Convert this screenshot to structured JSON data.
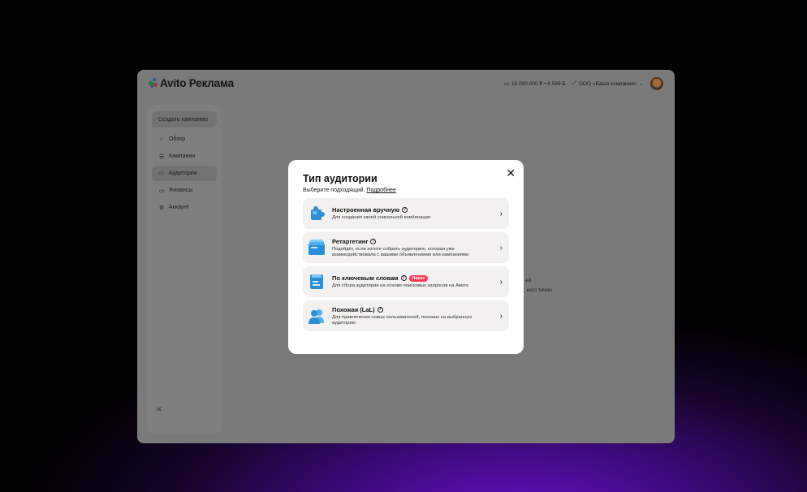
{
  "header": {
    "logo_text": "Avito Реклама",
    "balance": "15 000 000 ₽ • 6 589 Б",
    "company": "ООО «Ваша компания»"
  },
  "sidebar": {
    "create_label": "Создать кампанию",
    "items": [
      {
        "label": "Обзор",
        "icon": "overview-icon"
      },
      {
        "label": "Кампании",
        "icon": "list-icon"
      },
      {
        "label": "Аудитории",
        "icon": "users-icon"
      },
      {
        "label": "Финансы",
        "icon": "wallet-icon"
      },
      {
        "label": "Аккаунт",
        "icon": "gear-icon"
      }
    ],
    "collapse_glyph": "«"
  },
  "background": {
    "fragment_1": "ей.",
    "fragment_2": ", кого   точно"
  },
  "modal": {
    "title": "Тип аудитории",
    "subtitle": "Выберите подходящий.",
    "more_link": "Подробнее",
    "close_glyph": "✕",
    "options": [
      {
        "title": "Настроенная вручную",
        "desc": "Для создания своей уникальной комбинации",
        "badge": ""
      },
      {
        "title": "Ретаргетинг",
        "desc": "Подойдёт, если хотите собрать аудиторию, которая уже взаимодействовала с вашими объявлениями или кампаниями",
        "badge": ""
      },
      {
        "title": "По ключевым словам",
        "desc": "Для сбора аудитории на основе поисковых запросов на Авито",
        "badge": "Новое"
      },
      {
        "title": "Похожая (LaL)",
        "desc": "Для привлечения новых пользователей, похожих на выбранную аудиторию",
        "badge": ""
      }
    ]
  },
  "colors": {
    "accent_badge": "#ff3a5c",
    "logo_green": "#04e061",
    "logo_blue": "#0aa6ff",
    "logo_red": "#ff4053",
    "logo_purple": "#965eeb"
  }
}
